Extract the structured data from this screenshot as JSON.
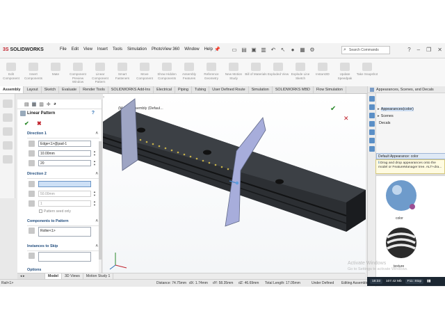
{
  "app": {
    "logo_prefix": "3S",
    "logo_name": "SOLIDWORKS",
    "menus": [
      "File",
      "Edit",
      "View",
      "Insert",
      "Tools",
      "Simulation",
      "PhotoView 360",
      "Window",
      "Help"
    ],
    "search_placeholder": "Search Commands"
  },
  "commands": [
    {
      "label": "Edit Component"
    },
    {
      "label": "Insert Components"
    },
    {
      "label": "Mate"
    },
    {
      "label": "Component Preview Window"
    },
    {
      "label": "Linear Component Pattern"
    },
    {
      "label": "Smart Fasteners"
    },
    {
      "label": "Move Component"
    },
    {
      "label": "Show Hidden Components"
    },
    {
      "label": "Assembly Features"
    },
    {
      "label": "Reference Geometry"
    },
    {
      "label": "New Motion Study"
    },
    {
      "label": "Bill of Materials"
    },
    {
      "label": "Exploded View"
    },
    {
      "label": "Explode Line Sketch"
    },
    {
      "label": "Instant3D"
    },
    {
      "label": "Update Speedpak"
    },
    {
      "label": "Take Snapshot"
    }
  ],
  "tabs": [
    "Assembly",
    "Layout",
    "Sketch",
    "Evaluate",
    "Render Tools",
    "SOLIDWORKS Add-Ins",
    "Electrical",
    "Piping",
    "Tubing",
    "User Defined Route",
    "Simulation",
    "SOLIDWORKS MBD",
    "Flow Simulation"
  ],
  "property_manager": {
    "title": "Linear Pattern",
    "direction1": {
      "header": "Direction 1",
      "edge": "Edge<1>@pad-1",
      "spacing": "10.00mm",
      "instances": "20"
    },
    "direction2": {
      "header": "Direction 2",
      "edge": "",
      "spacing": "50.00mm",
      "instances": "1",
      "seed_only": "Pattern seed only"
    },
    "components": {
      "header": "Components to Pattern",
      "item": "Roller<1>"
    },
    "skip": {
      "header": "Instances to Skip"
    },
    "options": {
      "header": "Options"
    }
  },
  "viewport": {
    "title": "(M Rail assembly (Defaul..."
  },
  "bottom_tabs": [
    "Model",
    "3D Views",
    "Motion Study 1"
  ],
  "status": {
    "left": "Rail<1>",
    "distance": "Distance: 74.75mm",
    "dx": "dX: 1.74mm",
    "dy": "dY: 58.35mm",
    "dz": "dZ: 46.69mm",
    "total": "Total Length: 17.05mm",
    "state": "Under Defined",
    "mode": "Editing Assemble"
  },
  "task_pane": {
    "title": "Appearances, Scenes, and Decals",
    "tree": [
      {
        "label": "Appearances(color)",
        "selected": true
      },
      {
        "label": "Scenes",
        "selected": false
      },
      {
        "label": "Decals",
        "selected": false
      }
    ],
    "default_appearance": "Default Appearance: color",
    "tip": "Drag and drop appearances onto the model or FeatureManager tree. ALT+dra...",
    "swatches": [
      {
        "label": "color",
        "color": "#6e9bcb"
      },
      {
        "label": "texture",
        "color": "#333333"
      }
    ]
  },
  "watermark": {
    "line1": "Activate Windows",
    "line2": "Go to Settings to activate Windows."
  },
  "systray": {
    "time": "18:33",
    "speed": "107.42 Mb",
    "item": "F11: Stop"
  },
  "colors": {
    "accent_red": "#c0202a",
    "ok_green": "#2b8a2b",
    "selection_blue": "#cde0f6",
    "rail_dark": "#222426"
  }
}
